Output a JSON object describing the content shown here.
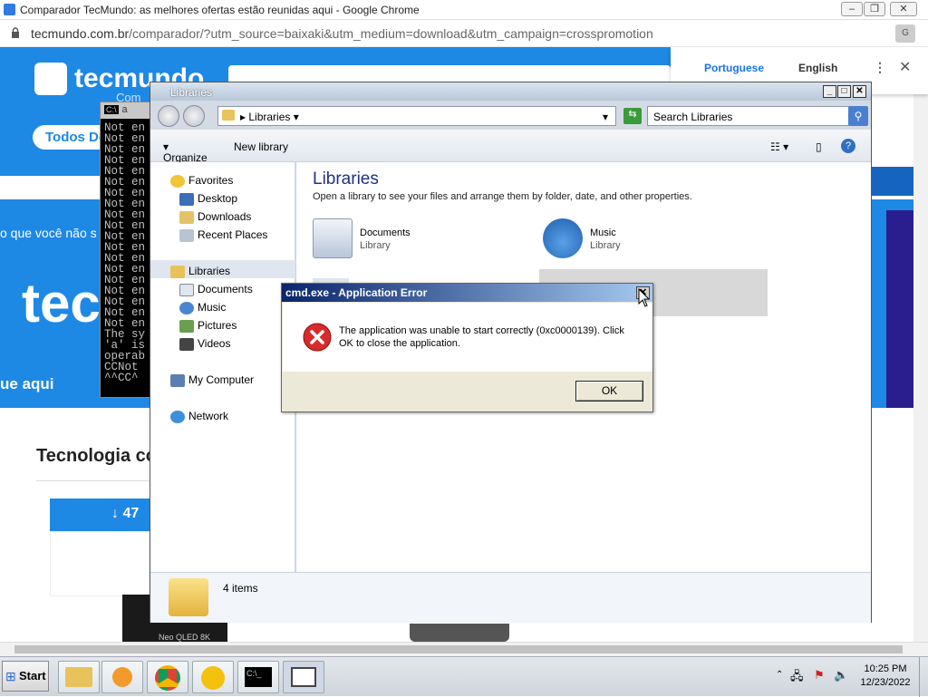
{
  "browser": {
    "window_title": "Comparador TecMundo: as melhores ofertas estão reunidas aqui - Google Chrome",
    "url_host": "tecmundo.com.br",
    "url_path": "/comparador/?utm_source=baixaki&utm_medium=download&utm_campaign=crosspromotion",
    "translate": {
      "lang1": "Portuguese",
      "lang2": "English"
    }
  },
  "webpage": {
    "logo_text": "tecmundo",
    "logo_sub": "Com",
    "pill_button": "Todos De",
    "banner_text": "o que você não s",
    "logo_big": "tec",
    "cta": "ue aqui",
    "heading": "Tecnologia co",
    "badge": "↓ 47",
    "thumb_text": "Neo QLED 8K"
  },
  "cmd": {
    "title": "a",
    "lines": [
      "Not en",
      "Not en",
      "Not en",
      "Not en",
      "Not en",
      "Not en",
      "Not en",
      "Not en",
      "Not en",
      "Not en",
      "Not en",
      "Not en",
      "Not en",
      "Not en",
      "Not en",
      "Not en",
      "Not en",
      "Not en",
      "Not en",
      "The sy",
      "'a' is",
      "operab",
      "CCNot ",
      "^^CC^"
    ]
  },
  "explorer": {
    "title": "Libraries",
    "path": "Libraries",
    "search_placeholder": "Search Libraries",
    "organize": "Organize",
    "new_library": "New library",
    "nav": {
      "favorites": "Favorites",
      "desktop": "Desktop",
      "downloads": "Downloads",
      "recent": "Recent Places",
      "libraries": "Libraries",
      "documents": "Documents",
      "music": "Music",
      "pictures": "Pictures",
      "videos": "Videos",
      "computer": "My Computer",
      "network": "Network"
    },
    "heading": "Libraries",
    "subheading": "Open a library to see your files and arrange them by folder, date, and other properties.",
    "libs": [
      {
        "name": "Documents",
        "type": "Library"
      },
      {
        "name": "Music",
        "type": "Library"
      }
    ],
    "status": "4 items"
  },
  "dialog": {
    "title": "cmd.exe - Application Error",
    "message": "The application was unable to start correctly (0xc0000139). Click OK to close the application.",
    "ok": "OK"
  },
  "taskbar": {
    "start": "Start",
    "time": "10:25 PM",
    "date": "12/23/2022"
  }
}
